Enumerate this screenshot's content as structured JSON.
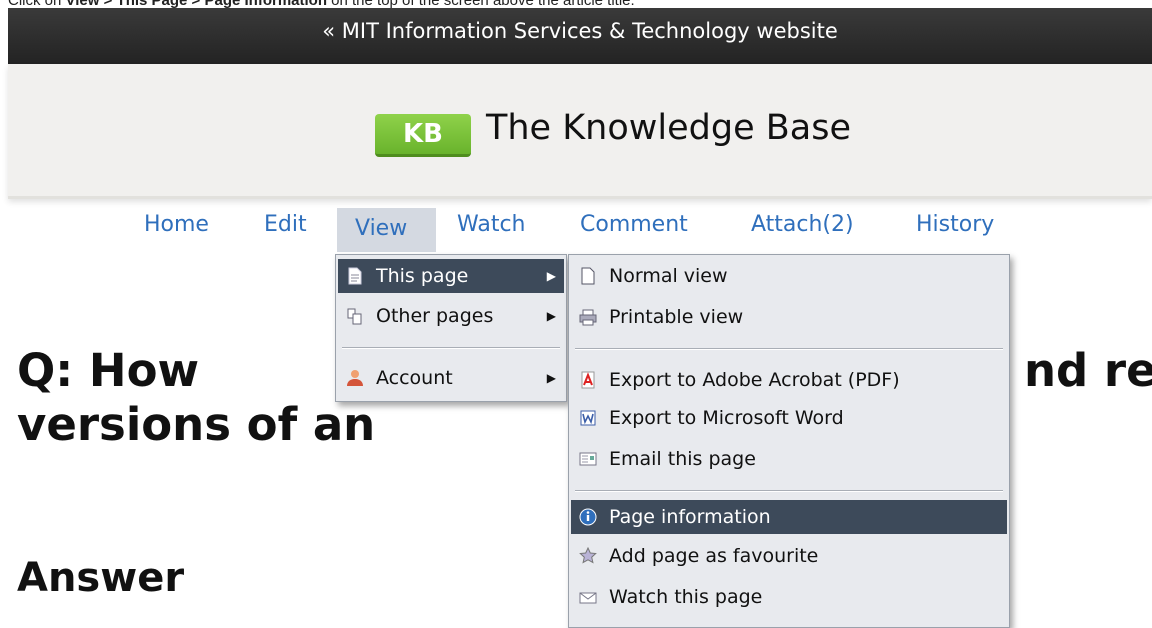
{
  "caption": {
    "prefix": "Click on ",
    "bold": "View > This Page > Page Information",
    "suffix": " on the top of the screen above the article title."
  },
  "topbar": {
    "link": "« MIT Information Services & Technology website"
  },
  "header": {
    "badge": "KB",
    "title": "The Knowledge Base"
  },
  "nav": {
    "home": "Home",
    "edit": "Edit",
    "view": "View",
    "watch": "Watch",
    "comment": "Comment",
    "attach": "Attach(2)",
    "history": "History"
  },
  "article": {
    "title_line1": "Q: How",
    "title_line1_right": "nd re",
    "title_line2": "versions of an",
    "answer_heading": "Answer"
  },
  "view_menu": {
    "this_page": "This page",
    "other_pages": "Other pages",
    "account": "Account"
  },
  "submenu": {
    "normal_view": "Normal view",
    "printable_view": "Printable view",
    "export_pdf": "Export to Adobe Acrobat (PDF)",
    "export_word": "Export to Microsoft Word",
    "email_page": "Email this page",
    "page_information": "Page information",
    "add_favourite": "Add page as favourite",
    "watch_page": "Watch this page"
  },
  "colors": {
    "nav_link": "#2f6fbc",
    "menu_active": "#3d4a5a",
    "menu_bg": "#e8eaee",
    "kb_green": "#7cc23b"
  }
}
